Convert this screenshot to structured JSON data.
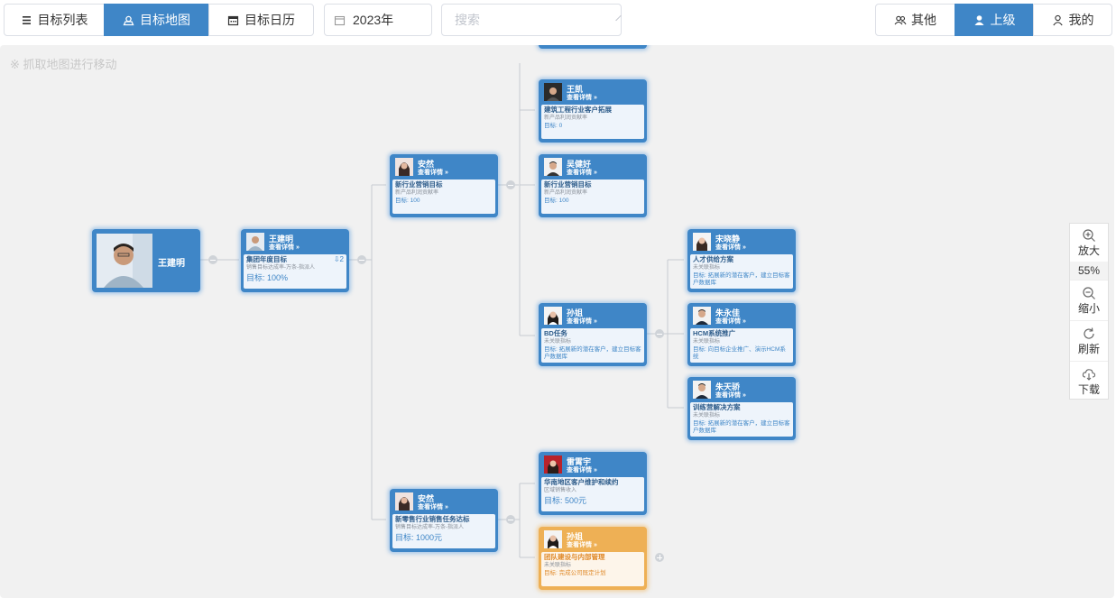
{
  "toolbar": {
    "view_tabs": [
      {
        "label": "目标列表",
        "icon": "list-icon"
      },
      {
        "label": "目标地图",
        "icon": "map-icon"
      },
      {
        "label": "目标日历",
        "icon": "calendar-icon"
      }
    ],
    "year": "2023年",
    "search_placeholder": "搜索",
    "scope_tabs": [
      {
        "label": "其他",
        "icon": "group-icon"
      },
      {
        "label": "上级",
        "icon": "user-solid-icon"
      },
      {
        "label": "我的",
        "icon": "user-icon"
      }
    ],
    "active_view": "目标地图",
    "active_scope": "上级",
    "accent_color": "#3f86c7"
  },
  "canvas": {
    "hint": "※ 抓取地图进行移动"
  },
  "root": {
    "name": "王建明"
  },
  "nodes": {
    "wjm": {
      "name": "王建明",
      "detail": "查看详情 »",
      "task": "集团年度目标",
      "meta": "销售目标达成率-万条-指派人",
      "target": "目标: 100%",
      "count": "2"
    },
    "ar1": {
      "name": "安然",
      "detail": "查看详情 »",
      "task": "新行业营销目标",
      "meta": "新产品利润贡献率",
      "target": "目标: 100"
    },
    "ar2": {
      "name": "安然",
      "detail": "查看详情 »",
      "task": "新零售行业销售任务达标",
      "meta": "销售目标达成率-万条-指派人",
      "target": "目标: 1000元"
    },
    "wk": {
      "name": "王凯",
      "detail": "查看详情 »",
      "task": "建筑工程行业客户拓展",
      "meta": "新产品利润贡献率",
      "target": "目标: 0"
    },
    "wjh": {
      "name": "吴健好",
      "detail": "查看详情 »",
      "task": "新行业营销目标",
      "meta": "新产品利润贡献率",
      "target": "目标: 100"
    },
    "sj1": {
      "name": "孙姐",
      "detail": "查看详情 »",
      "task": "BD任务",
      "meta": "未关联指标",
      "target": "目标: 拓展新的潜在客户，建立目标客户数据库"
    },
    "lxy": {
      "name": "雷霄宇",
      "detail": "查看详情 »",
      "task": "华南地区客户维护和续约",
      "meta": "区域销售收入",
      "target": "目标: 500元"
    },
    "sj2": {
      "name": "孙姐",
      "detail": "查看详情 »",
      "task": "团队建设与内部管理",
      "meta": "未关联指标",
      "target": "目标: 完成公司既定计划"
    },
    "sxj": {
      "name": "宋晓静",
      "detail": "查看详情 »",
      "task": "人才供给方案",
      "meta": "未关联指标",
      "target": "目标: 拓展新的潜在客户，建立目标客户数据库"
    },
    "zyj": {
      "name": "朱永佳",
      "detail": "查看详情 »",
      "task": "HCM系统推广",
      "meta": "未关联指标",
      "target": "目标: 向目标企业推广、演示HCM系统"
    },
    "ztj": {
      "name": "朱天骄",
      "detail": "查看详情 »",
      "task": "训练营解决方案",
      "meta": "未关联指标",
      "target": "目标: 拓展新的潜在客户，建立目标客户数据库"
    }
  },
  "zoom": {
    "zoom_in": "放大",
    "level": "55%",
    "zoom_out": "缩小",
    "refresh": "刷新",
    "download": "下载"
  }
}
